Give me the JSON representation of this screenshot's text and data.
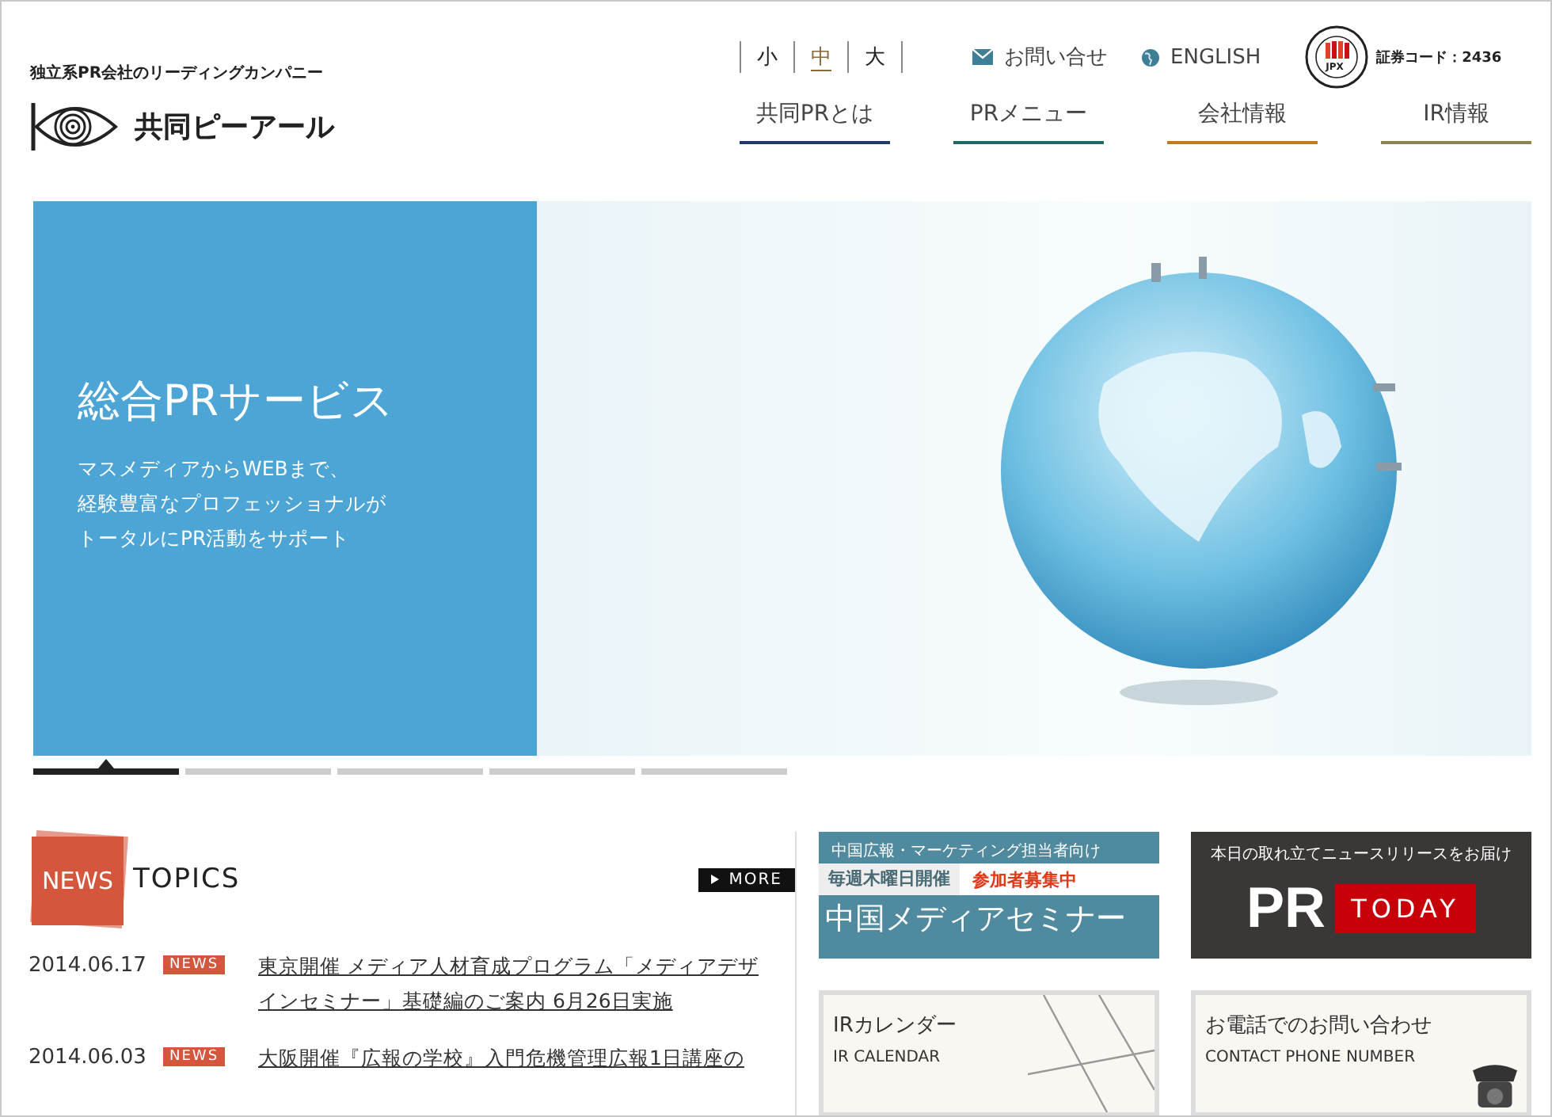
{
  "header": {
    "tagline": "独立系PR会社のリーディングカンパニー",
    "logo_text": "共同ピーアール",
    "font_sizes": [
      {
        "label": "小",
        "selected": false
      },
      {
        "label": "中",
        "selected": true
      },
      {
        "label": "大",
        "selected": false
      }
    ],
    "contact_link": "お問い合せ",
    "english_link": "ENGLISH",
    "jpx_label": "JPX",
    "securities_code": "証券コード：2436",
    "nav": [
      {
        "label": "共同PRとは",
        "color": "#1f3a6a"
      },
      {
        "label": "PRメニュー",
        "color": "#1f6a66"
      },
      {
        "label": "会社情報",
        "color": "#c27a1c"
      },
      {
        "label": "IR情報",
        "color": "#8f8350"
      }
    ]
  },
  "hero": {
    "title": "総合PRサービス",
    "lines": [
      "マスメディアからWEBまで、",
      "経験豊富なプロフェッショナルが",
      "トータルにPR活動をサポート"
    ],
    "slides": [
      {
        "selected": true
      },
      {
        "selected": false
      },
      {
        "selected": false
      },
      {
        "selected": false
      },
      {
        "selected": false
      }
    ]
  },
  "news": {
    "badge": "NEWS",
    "title": "TOPICS",
    "more": "MORE",
    "items": [
      {
        "date": "2014.06.17",
        "tag": "NEWS",
        "title": "東京開催  メディア人材育成プログラム「メディアデザインセミナー」基礎編のご案内  6月26日実施"
      },
      {
        "date": "2014.06.03",
        "tag": "NEWS",
        "title": "大阪開催『広報の学校』入門危機管理広報1日講座の"
      }
    ]
  },
  "banners": {
    "china": {
      "line1": "中国広報・マーケティング担当者向け",
      "line2_left": "毎週木曜日開催",
      "line2_right": "参加者募集中",
      "title": "中国メディアセミナー"
    },
    "pr_today": {
      "top": "本日の取れ立てニュースリリースをお届け",
      "pr": "PR",
      "today": "TODAY"
    },
    "ir_calendar": {
      "title": "IRカレンダー",
      "subtitle": "IR CALENDAR"
    },
    "phone": {
      "title": "お電話でのお問い合わせ",
      "subtitle": "CONTACT PHONE NUMBER"
    }
  }
}
